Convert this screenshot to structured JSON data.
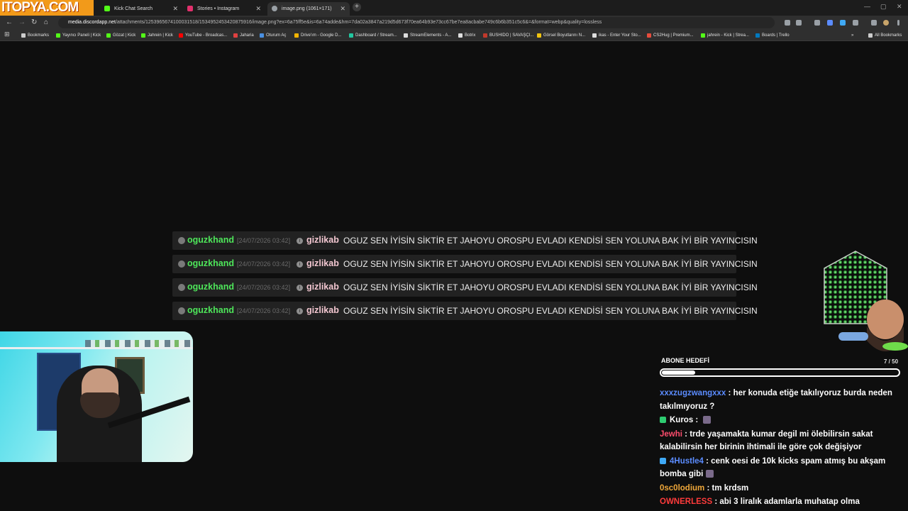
{
  "logo": "ITOPYA.COM",
  "tabs": [
    {
      "label": "Kick Chat Search",
      "fav_color": "#53fc18"
    },
    {
      "label": "Stories • Instagram",
      "fav_color": "#e1306c"
    },
    {
      "label": "image.png (1061×171)",
      "fav_color": "#9aa0a6"
    }
  ],
  "window_controls": [
    "—",
    "▢",
    "✕"
  ],
  "url": {
    "host": "media.discordapp.net",
    "path": "/attachments/1253965674100031518/1534952453420875916/image.png?ex=6a75ff5e&is=6a74adde&hm=7da02a3847a219d5d673f70ea64b93e73cc67be7ea8acbabe749c6b6b351c5c6&=&format=webp&quality=lossless"
  },
  "bookmarks": [
    {
      "label": "Bookmarks",
      "color": "#cccccc"
    },
    {
      "label": "Yayıncı Paneli | Kick",
      "color": "#53fc18"
    },
    {
      "label": "Gözat | Kick",
      "color": "#53fc18"
    },
    {
      "label": "Jahrein | Kick",
      "color": "#53fc18"
    },
    {
      "label": "YouTube - Broadcas...",
      "color": "#ff0000"
    },
    {
      "label": "Jaharia",
      "color": "#e04040"
    },
    {
      "label": "Oturum Aç",
      "color": "#4a90e2"
    },
    {
      "label": "Drive'ım - Google D...",
      "color": "#f4b400"
    },
    {
      "label": "Dashboard / Stream...",
      "color": "#22c7a0"
    },
    {
      "label": "StreamElements - A...",
      "color": "#dddddd"
    },
    {
      "label": "Botrix",
      "color": "#dddddd"
    },
    {
      "label": "BUSHIDO | SAVAŞÇI...",
      "color": "#c0392b"
    },
    {
      "label": "Görsel Boyutlarını N...",
      "color": "#f1c40f"
    },
    {
      "label": "ikas - Enter Your Sto...",
      "color": "#dddddd"
    },
    {
      "label": "CS2Hug | Premium...",
      "color": "#e74c3c"
    },
    {
      "label": "jahrein - Kick | Strea...",
      "color": "#53fc18"
    },
    {
      "label": "Boards | Trello",
      "color": "#0079bf"
    },
    {
      "label": "All Bookmarks",
      "color": "#cccccc"
    }
  ],
  "chat_messages": [
    {
      "user": "oguzkhand",
      "timestamp": "[24/07/2026 03:42]",
      "target": "gizlikab",
      "message": "OGUZ SEN İYİSİN SİKTİR ET JAHOYU OROSPU EVLADI KENDİSİ SEN YOLUNA BAK İYİ BİR YAYINCISIN"
    },
    {
      "user": "oguzkhand",
      "timestamp": "[24/07/2026 03:42]",
      "target": "gizlikab",
      "message": "OGUZ SEN İYİSİN SİKTİR ET JAHOYU OROSPU EVLADI KENDİSİ SEN YOLUNA BAK İYİ BİR YAYINCISIN"
    },
    {
      "user": "oguzkhand",
      "timestamp": "[24/07/2026 03:42]",
      "target": "gizlikab",
      "message": "OGUZ SEN İYİSİN SİKTİR ET JAHOYU OROSPU EVLADI KENDİSİ SEN YOLUNA BAK İYİ BİR YAYINCISIN"
    },
    {
      "user": "oguzkhand",
      "timestamp": "[24/07/2026 03:42]",
      "target": "gizlikab",
      "message": "OGUZ SEN İYİSİN SİKTİR ET JAHOYU OROSPU EVLADI KENDİSİ SEN YOLUNA BAK İYİ BİR YAYINCISIN"
    }
  ],
  "sub_goal": {
    "label": "ABONE HEDEFİ",
    "count": "7 / 50",
    "progress": 0.14
  },
  "side_chat": [
    {
      "user": "xxxzugzwangxxx",
      "color": "#5b8cff",
      "badge": "",
      "text": "her konuda etiğe takılıyoruz burda neden takılmıyoruz ?",
      "emote": false
    },
    {
      "user": "Kuros",
      "color": "#ffffff",
      "badge": "#2ecc71",
      "text": "",
      "emote": true
    },
    {
      "user": "Jewhi",
      "color": "#ff4d6d",
      "badge": "",
      "text": "trde yaşamakta kumar degil mi ölebilirsin sakat kalabilirsin her birinin ihtimali ile göre çok değişiyor",
      "emote": false
    },
    {
      "user": "4Hustle4",
      "color": "#5b8cff",
      "badge": "#3fa9f5",
      "text": "cenk oesi de 10k kicks spam atmış bu akşam bomba gibi",
      "emote": true
    },
    {
      "user": "0sc0lodium",
      "color": "#f0a83a",
      "badge": "",
      "text": "tm krdsm",
      "emote": false
    },
    {
      "user": "OWNERLESS",
      "color": "#ff3b3b",
      "badge": "",
      "text": "abi 3 liralık adamlarla muhatap olma",
      "emote": false
    }
  ]
}
